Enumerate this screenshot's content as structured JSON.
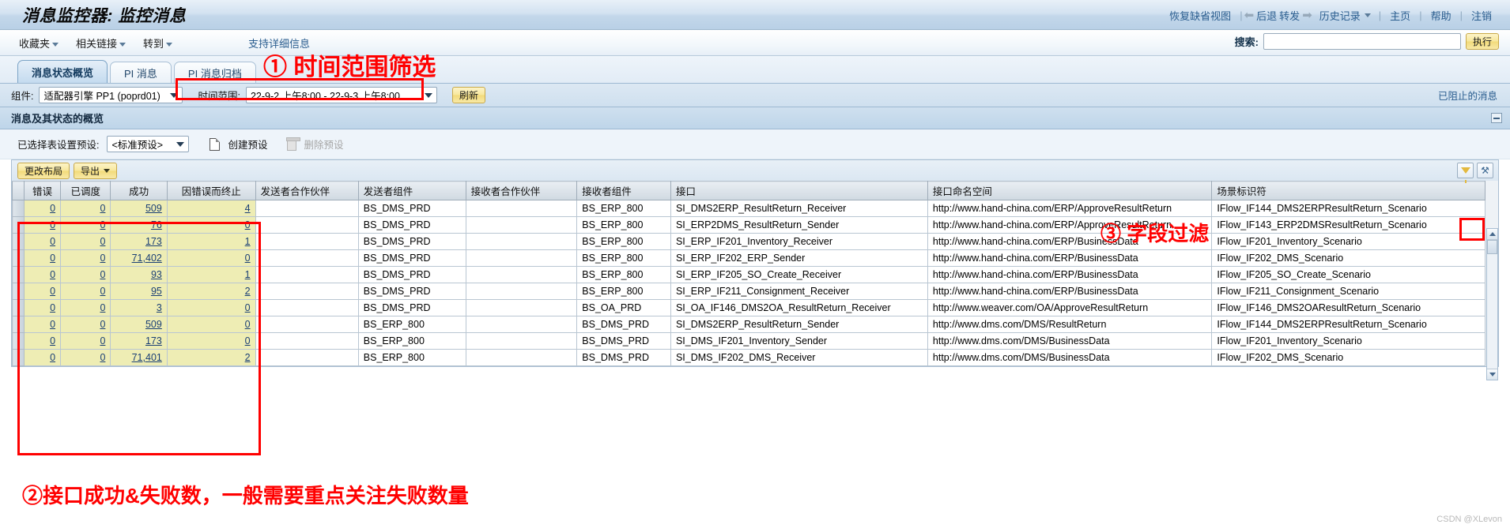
{
  "header": {
    "title": "消息监控器: 监控消息",
    "nav": [
      {
        "label": "恢复缺省视图",
        "icon": ""
      },
      {
        "label": "后退",
        "icon": "back-arrow-icon"
      },
      {
        "label": "转发",
        "icon": "forward-arrow-icon"
      },
      {
        "label": "历史记录",
        "icon": "chevron-down-icon"
      },
      {
        "label": "主页",
        "icon": ""
      },
      {
        "label": "帮助",
        "icon": ""
      },
      {
        "label": "注销",
        "icon": ""
      }
    ]
  },
  "menubar": {
    "items": [
      "收藏夹",
      "相关链接",
      "转到"
    ],
    "support_link": "支持详细信息",
    "search_label": "搜索:",
    "search_value": "",
    "search_placeholder": "",
    "go_button": "执行"
  },
  "tabs": [
    {
      "label": "消息状态概览",
      "active": true
    },
    {
      "label": "PI 消息",
      "active": false
    },
    {
      "label": "PI 消息归档",
      "active": false
    }
  ],
  "filterbar": {
    "component_label": "组件:",
    "component_value": "适配器引擎 PP1 (poprd01)",
    "timerange_label": "时间范围:",
    "timerange_value": "22-9-2 上午8:00 - 22-9-3 上午8:00",
    "refresh_button": "刷新"
  },
  "section": {
    "title": "消息及其状态的概览",
    "blocked_link": "已阻止的消息"
  },
  "preset": {
    "label": "已选择表设置预设:",
    "value": "<标准预设>",
    "create": "创建预设",
    "delete": "删除预设"
  },
  "table_toolbar": {
    "change_layout": "更改布局",
    "export": "导出",
    "filter_icon": "filter-funnel-icon",
    "settings_icon": "table-settings-icon"
  },
  "table": {
    "columns": [
      {
        "key": "error",
        "label": "错误",
        "type": "num"
      },
      {
        "key": "scheduled",
        "label": "已调度",
        "type": "num"
      },
      {
        "key": "success",
        "label": "成功",
        "type": "num"
      },
      {
        "key": "cancelled",
        "label": "因错误而终止",
        "type": "num"
      },
      {
        "key": "sender_partner",
        "label": "发送者合作伙伴",
        "type": "text"
      },
      {
        "key": "sender_component",
        "label": "发送者组件",
        "type": "text"
      },
      {
        "key": "receiver_partner",
        "label": "接收者合作伙伴",
        "type": "text"
      },
      {
        "key": "receiver_component",
        "label": "接收者组件",
        "type": "text"
      },
      {
        "key": "interface",
        "label": "接口",
        "type": "text"
      },
      {
        "key": "namespace",
        "label": "接口命名空间",
        "type": "text"
      },
      {
        "key": "scenario",
        "label": "场景标识符",
        "type": "text"
      }
    ],
    "rows": [
      {
        "error": "0",
        "scheduled": "0",
        "success": "509",
        "cancelled": "4",
        "sender_partner": "",
        "sender_component": "BS_DMS_PRD",
        "receiver_partner": "",
        "receiver_component": "BS_ERP_800",
        "interface": "SI_DMS2ERP_ResultReturn_Receiver",
        "namespace": "http://www.hand-china.com/ERP/ApproveResultReturn",
        "scenario": "IFlow_IF144_DMS2ERPResultReturn_Scenario"
      },
      {
        "error": "0",
        "scheduled": "0",
        "success": "76",
        "cancelled": "0",
        "sender_partner": "",
        "sender_component": "BS_DMS_PRD",
        "receiver_partner": "",
        "receiver_component": "BS_ERP_800",
        "interface": "SI_ERP2DMS_ResultReturn_Sender",
        "namespace": "http://www.hand-china.com/ERP/ApproveResultReturn",
        "scenario": "IFlow_IF143_ERP2DMSResultReturn_Scenario"
      },
      {
        "error": "0",
        "scheduled": "0",
        "success": "173",
        "cancelled": "1",
        "sender_partner": "",
        "sender_component": "BS_DMS_PRD",
        "receiver_partner": "",
        "receiver_component": "BS_ERP_800",
        "interface": "SI_ERP_IF201_Inventory_Receiver",
        "namespace": "http://www.hand-china.com/ERP/BusinessData",
        "scenario": "IFlow_IF201_Inventory_Scenario"
      },
      {
        "error": "0",
        "scheduled": "0",
        "success": "71,402",
        "cancelled": "0",
        "sender_partner": "",
        "sender_component": "BS_DMS_PRD",
        "receiver_partner": "",
        "receiver_component": "BS_ERP_800",
        "interface": "SI_ERP_IF202_ERP_Sender",
        "namespace": "http://www.hand-china.com/ERP/BusinessData",
        "scenario": "IFlow_IF202_DMS_Scenario"
      },
      {
        "error": "0",
        "scheduled": "0",
        "success": "93",
        "cancelled": "1",
        "sender_partner": "",
        "sender_component": "BS_DMS_PRD",
        "receiver_partner": "",
        "receiver_component": "BS_ERP_800",
        "interface": "SI_ERP_IF205_SO_Create_Receiver",
        "namespace": "http://www.hand-china.com/ERP/BusinessData",
        "scenario": "IFlow_IF205_SO_Create_Scenario"
      },
      {
        "error": "0",
        "scheduled": "0",
        "success": "95",
        "cancelled": "2",
        "sender_partner": "",
        "sender_component": "BS_DMS_PRD",
        "receiver_partner": "",
        "receiver_component": "BS_ERP_800",
        "interface": "SI_ERP_IF211_Consignment_Receiver",
        "namespace": "http://www.hand-china.com/ERP/BusinessData",
        "scenario": "IFlow_IF211_Consignment_Scenario"
      },
      {
        "error": "0",
        "scheduled": "0",
        "success": "3",
        "cancelled": "0",
        "sender_partner": "",
        "sender_component": "BS_DMS_PRD",
        "receiver_partner": "",
        "receiver_component": "BS_OA_PRD",
        "interface": "SI_OA_IF146_DMS2OA_ResultReturn_Receiver",
        "namespace": "http://www.weaver.com/OA/ApproveResultReturn",
        "scenario": "IFlow_IF146_DMS2OAResultReturn_Scenario"
      },
      {
        "error": "0",
        "scheduled": "0",
        "success": "509",
        "cancelled": "0",
        "sender_partner": "",
        "sender_component": "BS_ERP_800",
        "receiver_partner": "",
        "receiver_component": "BS_DMS_PRD",
        "interface": "SI_DMS2ERP_ResultReturn_Sender",
        "namespace": "http://www.dms.com/DMS/ResultReturn",
        "scenario": "IFlow_IF144_DMS2ERPResultReturn_Scenario"
      },
      {
        "error": "0",
        "scheduled": "0",
        "success": "173",
        "cancelled": "0",
        "sender_partner": "",
        "sender_component": "BS_ERP_800",
        "receiver_partner": "",
        "receiver_component": "BS_DMS_PRD",
        "interface": "SI_DMS_IF201_Inventory_Sender",
        "namespace": "http://www.dms.com/DMS/BusinessData",
        "scenario": "IFlow_IF201_Inventory_Scenario"
      },
      {
        "error": "0",
        "scheduled": "0",
        "success": "71,401",
        "cancelled": "2",
        "sender_partner": "",
        "sender_component": "BS_ERP_800",
        "receiver_partner": "",
        "receiver_component": "BS_DMS_PRD",
        "interface": "SI_DMS_IF202_DMS_Receiver",
        "namespace": "http://www.dms.com/DMS/BusinessData",
        "scenario": "IFlow_IF202_DMS_Scenario"
      }
    ]
  },
  "annotations": {
    "a1": "① 时间范围筛选",
    "a2": "②接口成功&失败数，一般需要重点关注失败数量",
    "a3": "③ 字段过滤",
    "color": "#ff0000"
  },
  "watermark": "CSDN @XLevon"
}
